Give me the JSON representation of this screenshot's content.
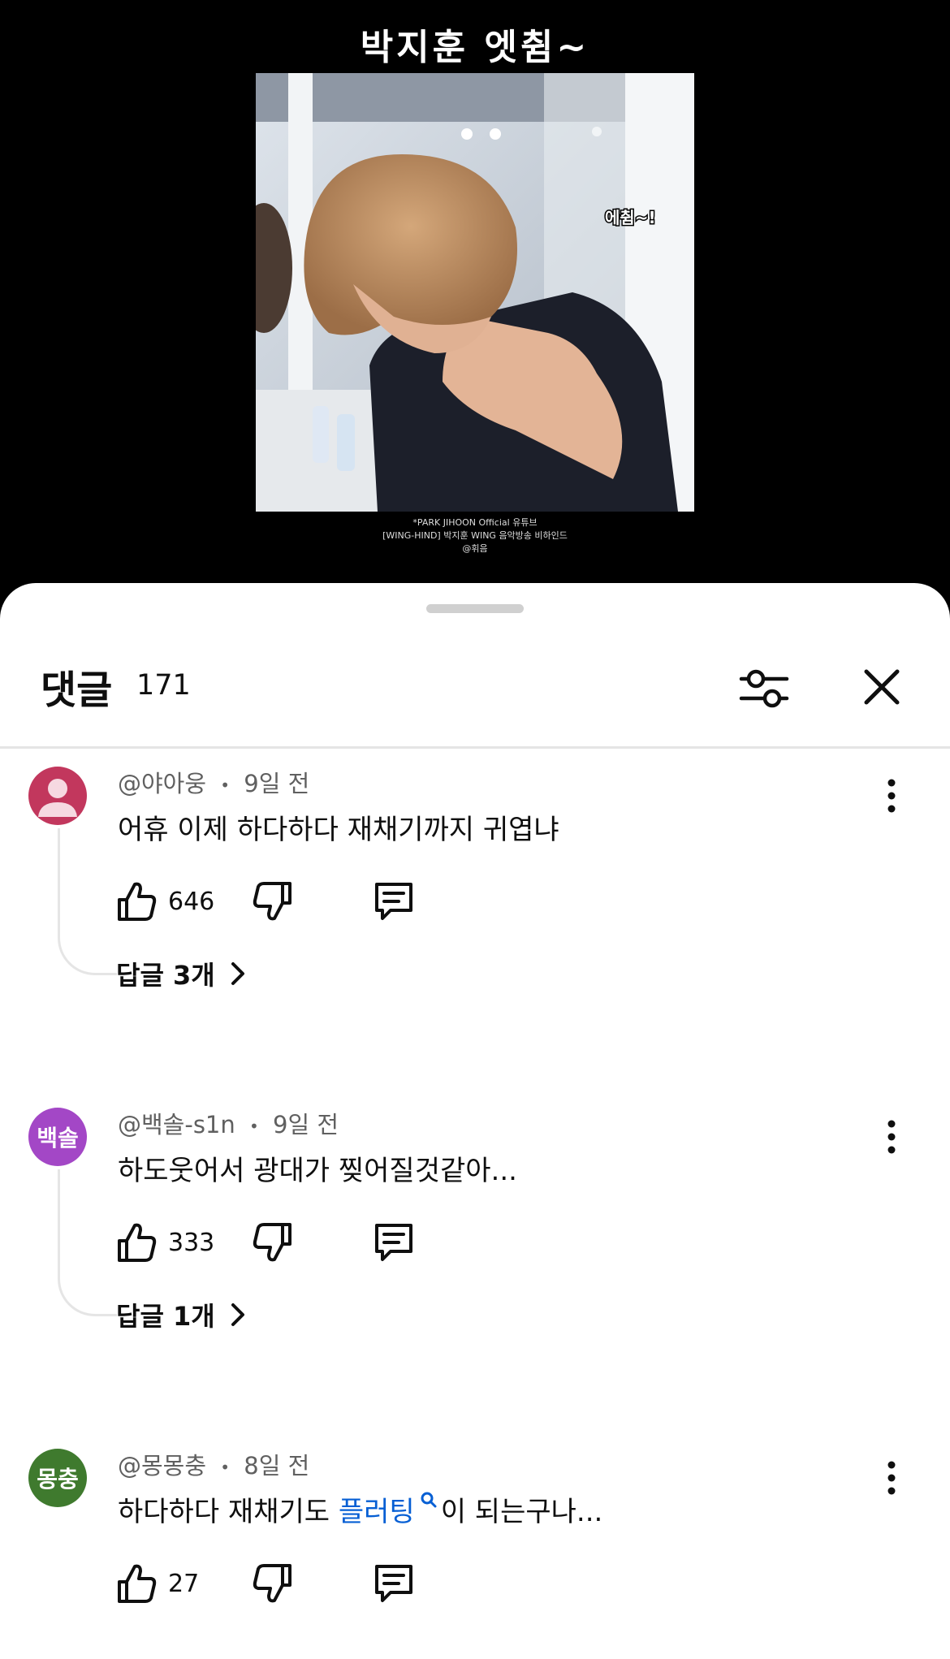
{
  "video": {
    "title": "박지훈 엣췸~",
    "overlay_text": "에췸~!",
    "caption_line1": "*PARK JIHOON Official 유튜브",
    "caption_line2": "[WING-HIND] 박지훈 WING 음악방송 비하인드",
    "caption_line3": "@휘음"
  },
  "comments_header": {
    "title": "댓글",
    "count": "171",
    "filter_icon": "sliders-icon",
    "close_icon": "close-icon"
  },
  "comments": [
    {
      "author": "@야아웅",
      "time": "9일 전",
      "text": "어휴 이제 하다하다 재채기까지 귀엽냐",
      "likes": "646",
      "replies_label": "답글 3개",
      "avatar_text": "",
      "avatar_color": "#c2375d"
    },
    {
      "author": "@백솔-s1n",
      "time": "9일 전",
      "text": "하도웃어서 광대가 찢어질것같아...",
      "likes": "333",
      "replies_label": "답글 1개",
      "avatar_text": "백솔",
      "avatar_color": "#a347c6"
    },
    {
      "author": "@몽몽충",
      "time": "8일 전",
      "text_before": "하다하다 재채기도 ",
      "text_link": "플러팅",
      "text_after": "이 되는구나...",
      "likes": "27",
      "avatar_text": "몽충",
      "avatar_color": "#3f7a2e"
    }
  ],
  "separator": "•"
}
